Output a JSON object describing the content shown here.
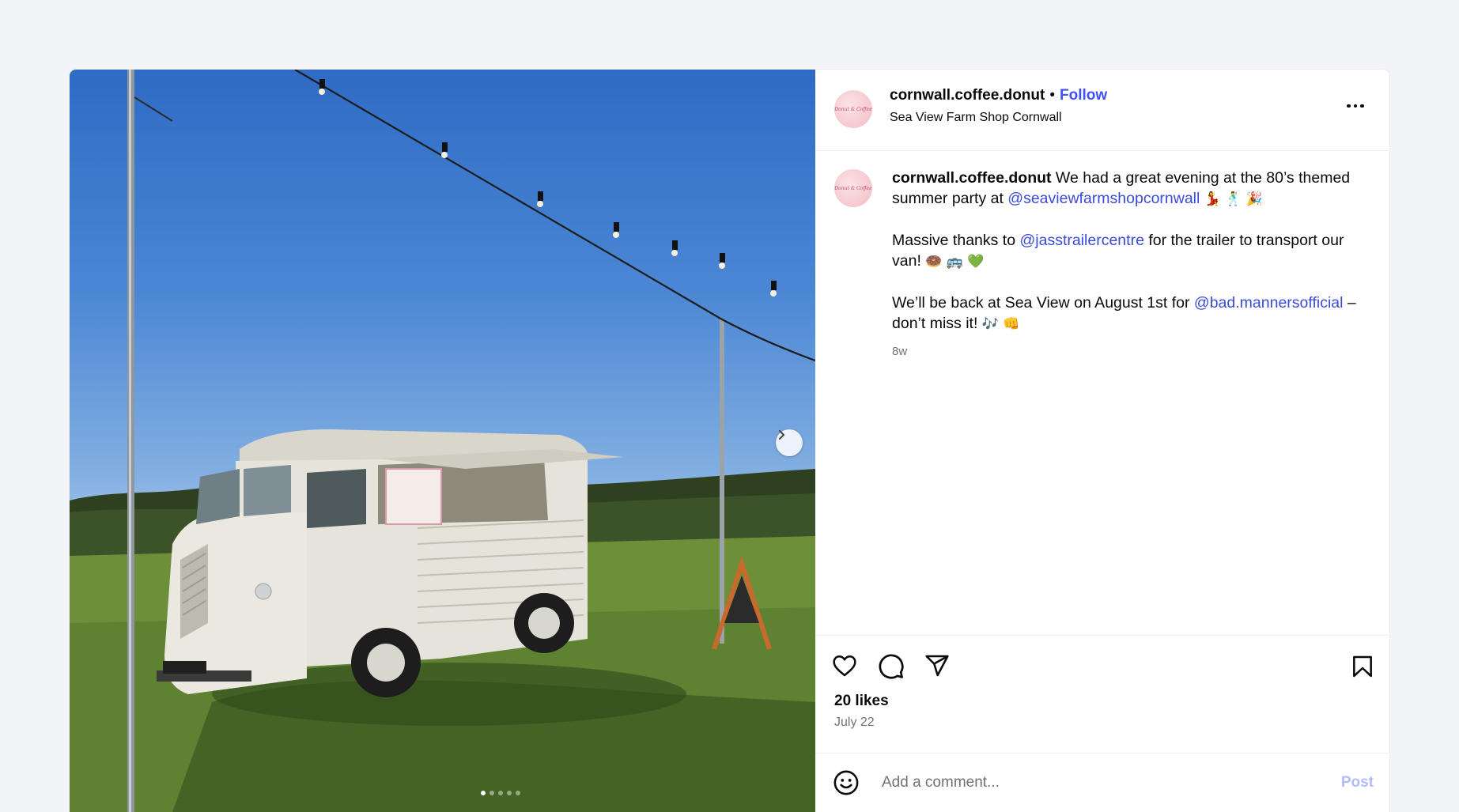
{
  "post": {
    "username": "cornwall.coffee.donut",
    "follow_label": "Follow",
    "separator": "•",
    "location": "Sea View Farm Shop Cornwall",
    "avatar_text": "Donut & Coffee",
    "more_icon": "more-horizontal-icon"
  },
  "caption": {
    "username": "cornwall.coffee.donut",
    "line1_text": " We had a great evening at the 80’s themed summer party at ",
    "mention1": "@seaviewfarmshopcornwall",
    "line1_emoji": " 💃 🕺 🎉",
    "line2_text": "Massive thanks to ",
    "mention2": "@jasstrailercentre",
    "line2_text_after": " for the trailer to transport our van! ",
    "line2_emoji": "🍩 🚌 💚",
    "line3_text": "We’ll be back at Sea View on August 1st for ",
    "mention3": "@bad.mannersofficial",
    "line3_text_after": " – don’t miss it! ",
    "line3_emoji": "🎶 👊",
    "time_ago": "8w"
  },
  "actions": {
    "like_icon": "heart-icon",
    "comment_icon": "comment-icon",
    "share_icon": "send-icon",
    "save_icon": "bookmark-icon",
    "likes": "20 likes",
    "date": "July 22"
  },
  "comment": {
    "placeholder": "Add a comment...",
    "post_label": "Post",
    "emoji_icon": "smiley-icon"
  },
  "media": {
    "next_icon": "chevron-right-icon",
    "slide_count": 5,
    "active_slide": 1,
    "alt": "Vintage food van in a field"
  },
  "colors": {
    "accent": "#4150f7",
    "mention": "#3a4bd8",
    "muted": "#737373",
    "post_disabled": "#b3bbf8"
  }
}
